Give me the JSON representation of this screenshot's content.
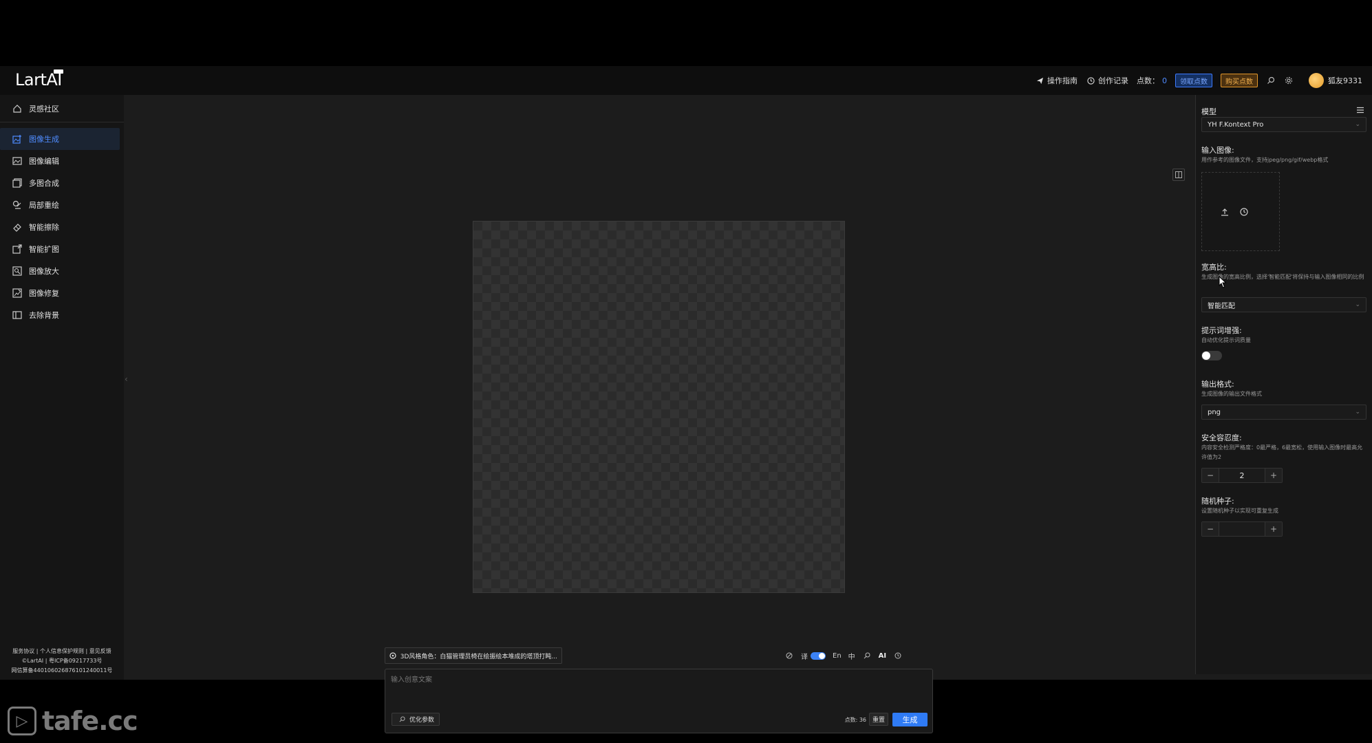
{
  "header": {
    "logo": "LartAI",
    "guide_link": "操作指南",
    "history_link": "创作记录",
    "points_label": "点数：",
    "points_value": "0",
    "claim_button": "领取点数",
    "buy_button": "购买点数",
    "user_name": "狐友9331"
  },
  "sidebar": {
    "top_item": "灵感社区",
    "items": [
      {
        "label": "图像生成",
        "icon": "image-plus-icon"
      },
      {
        "label": "图像编辑",
        "icon": "image-edit-icon"
      },
      {
        "label": "多图合成",
        "icon": "layers-icon"
      },
      {
        "label": "局部重绘",
        "icon": "brush-icon"
      },
      {
        "label": "智能擦除",
        "icon": "eraser-icon"
      },
      {
        "label": "智能扩图",
        "icon": "expand-icon"
      },
      {
        "label": "图像放大",
        "icon": "zoom-icon"
      },
      {
        "label": "图像修复",
        "icon": "repair-icon"
      },
      {
        "label": "去除背景",
        "icon": "remove-bg-icon"
      }
    ],
    "footer": {
      "line1": "服务协议 | 个人信息保护规则 | 意见反馈",
      "line2": "©LartAI | 粤ICP备09217733号",
      "line3": "网信算备440106026876101240011号"
    }
  },
  "prompt": {
    "preset_chip": "3D风格角色：白猫管理员椅在绘振绘本堆成的塔顶打盹...",
    "toggle_label": "译",
    "lang_en": "En",
    "lang_zh": "中",
    "ai_label": "AI",
    "placeholder": "输入创意文案",
    "optimize_button": "优化参数",
    "cost": "点数: 36",
    "reset_button": "重置",
    "generate_button": "生成"
  },
  "right_panel": {
    "model_label": "模型",
    "model_value": "YH F.Kontext Pro",
    "input_image_label": "输入图像:",
    "input_image_desc": "用作参考的图像文件，支持jpeg/png/gif/webp格式",
    "aspect_label": "宽高比:",
    "aspect_desc": "生成图像的宽高比例，选择'智能匹配'将保持与输入图像相同的比例",
    "aspect_value": "智能匹配",
    "prompt_enhance_label": "提示词增强:",
    "prompt_enhance_desc": "自动优化提示词质量",
    "output_format_label": "输出格式:",
    "output_format_desc": "生成图像的输出文件格式",
    "output_format_value": "png",
    "safety_label": "安全容忍度:",
    "safety_desc": "内容安全检测严格度：0最严格，6最宽松，使用输入图像时最高允许值为2",
    "safety_value": "2",
    "seed_label": "随机种子:",
    "seed_desc": "设置随机种子以实现可重复生成",
    "seed_value": ""
  },
  "watermark": "tafe.cc",
  "colors": {
    "accent": "#2f7bf5",
    "buy": "#f2b14e",
    "background": "#1c1c1c"
  }
}
